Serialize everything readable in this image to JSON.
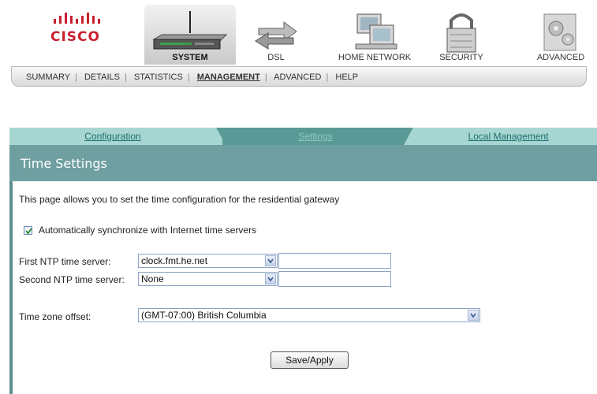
{
  "brand": {
    "name": "CISCO"
  },
  "nav": {
    "items": [
      {
        "label": "SYSTEM",
        "icon": "router-icon",
        "active": true
      },
      {
        "label": "DSL",
        "icon": "arrows-icon"
      },
      {
        "label": "HOME NETWORK",
        "icon": "computers-icon"
      },
      {
        "label": "SECURITY",
        "icon": "lock-icon"
      },
      {
        "label": "ADVANCED",
        "icon": "gears-icon"
      }
    ]
  },
  "subnav": {
    "items": [
      "SUMMARY",
      "DETAILS",
      "STATISTICS",
      "MANAGEMENT",
      "ADVANCED",
      "HELP"
    ],
    "current": "MANAGEMENT"
  },
  "tabs": [
    "Configuration",
    "Settings",
    "Local Management"
  ],
  "active_tab": "Settings",
  "page": {
    "title": "Time Settings",
    "description": "This page allows you to set the time configuration for the residential gateway"
  },
  "sync": {
    "label": "Automatically synchronize with Internet time servers",
    "checked": true
  },
  "ntp1": {
    "label": "First NTP time server:",
    "value": "clock.fmt.he.net",
    "custom": ""
  },
  "ntp2": {
    "label": "Second NTP time server:",
    "value": "None",
    "custom": ""
  },
  "timezone": {
    "label": "Time zone offset:",
    "value": "(GMT-07:00) British Columbia"
  },
  "save_label": "Save/Apply",
  "colors": {
    "brand": "#c8202f",
    "tab_active": "#5a9a96",
    "tab_inactive": "#a7d6d2",
    "header": "#6f9fa0"
  }
}
